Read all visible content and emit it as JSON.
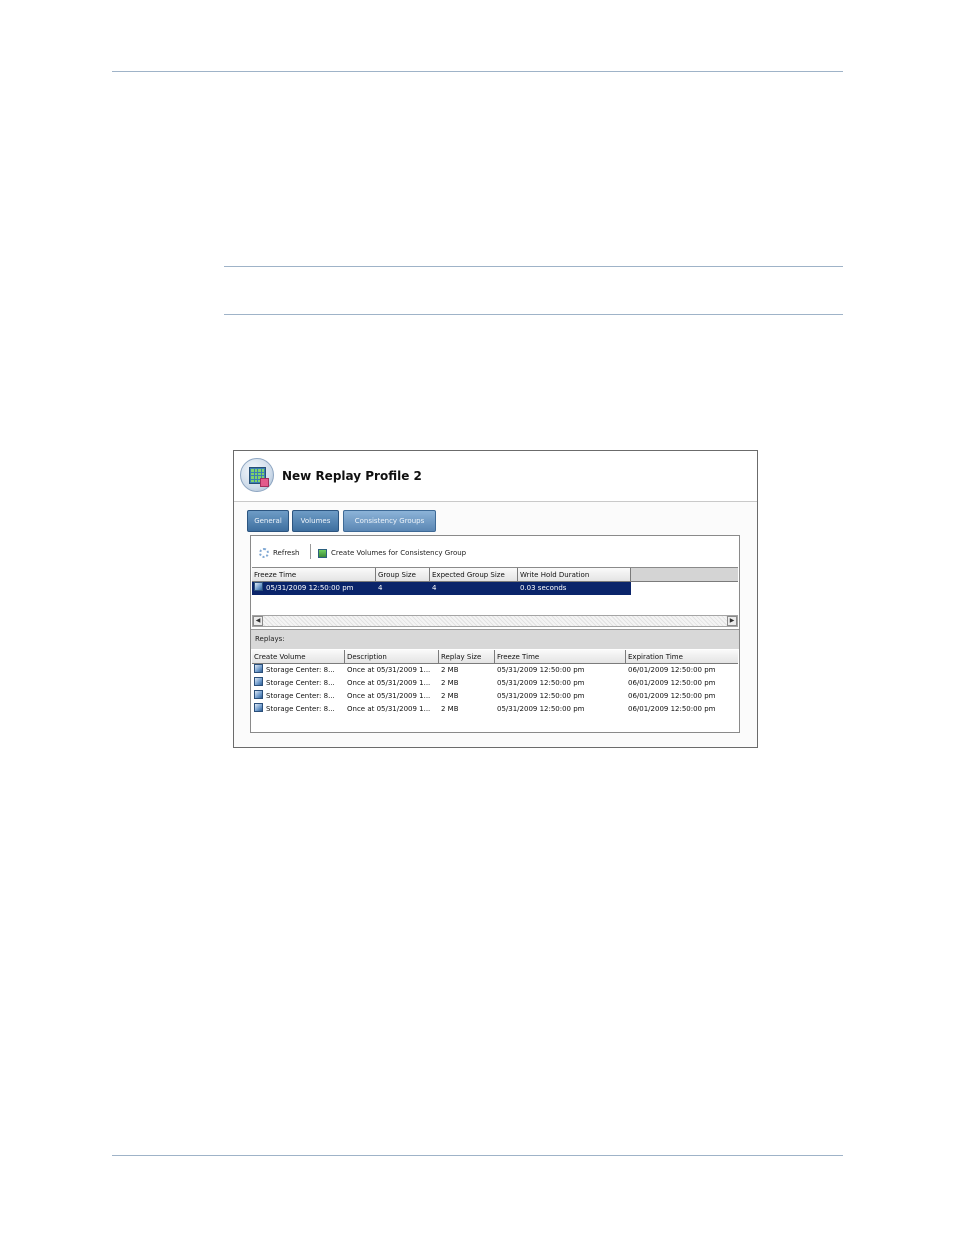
{
  "window": {
    "title": "New Replay Profile 2",
    "icon": "replay-profile-icon"
  },
  "tabs": [
    {
      "label": "General",
      "active": false
    },
    {
      "label": "Volumes",
      "active": false
    },
    {
      "label": "Consistency Groups",
      "active": true
    }
  ],
  "toolbar": {
    "refresh_label": "Refresh",
    "create_label": "Create Volumes for Consistency Group"
  },
  "groups_table": {
    "columns": [
      "Freeze Time",
      "Group Size",
      "Expected Group Size",
      "Write Hold Duration"
    ],
    "rows": [
      {
        "freeze_time": "05/31/2009 12:50:00 pm",
        "group_size": "4",
        "expected_group_size": "4",
        "write_hold_duration": "0.03 seconds",
        "selected": true
      }
    ]
  },
  "replays": {
    "label": "Replays:",
    "columns": [
      "Create Volume",
      "Description",
      "Replay Size",
      "Freeze Time",
      "Expiration Time"
    ],
    "rows": [
      {
        "create_volume": "Storage Center: 8...",
        "description": "Once at 05/31/2009 1...",
        "replay_size": "2 MB",
        "freeze_time": "05/31/2009 12:50:00 pm",
        "expiration_time": "06/01/2009 12:50:00 pm"
      },
      {
        "create_volume": "Storage Center: 8...",
        "description": "Once at 05/31/2009 1...",
        "replay_size": "2 MB",
        "freeze_time": "05/31/2009 12:50:00 pm",
        "expiration_time": "06/01/2009 12:50:00 pm"
      },
      {
        "create_volume": "Storage Center: 8...",
        "description": "Once at 05/31/2009 1...",
        "replay_size": "2 MB",
        "freeze_time": "05/31/2009 12:50:00 pm",
        "expiration_time": "06/01/2009 12:50:00 pm"
      },
      {
        "create_volume": "Storage Center: 8...",
        "description": "Once at 05/31/2009 1...",
        "replay_size": "2 MB",
        "freeze_time": "05/31/2009 12:50:00 pm",
        "expiration_time": "06/01/2009 12:50:00 pm"
      }
    ]
  },
  "colors": {
    "tab_fill": "#3e6f9f",
    "selection": "#0a246a",
    "page_rule": "#9fb3c8"
  }
}
